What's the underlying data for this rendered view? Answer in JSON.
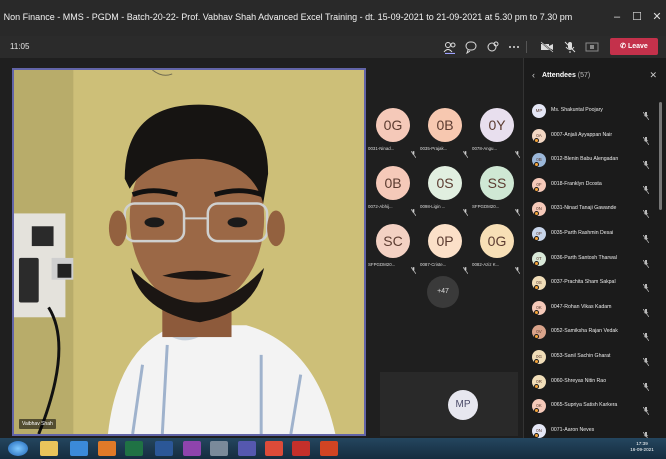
{
  "window": {
    "title": "Non Finance - MMS - PGDM - Batch-20-22- Prof. Vabhav Shah Advanced Excel Training - dt. 15-09-2021 to 21-09-2021 at 5.30 pm to 7.30 pm",
    "min_glyph": "–",
    "max_glyph": "☐",
    "close_glyph": "✕"
  },
  "callbar": {
    "timer": "11:05",
    "leave_label": "Leave",
    "icons": [
      "people-icon",
      "chat-icon",
      "reactions-icon",
      "more-icon",
      "camera-off-icon",
      "mic-off-icon",
      "share-icon"
    ]
  },
  "video": {
    "speaker_name": "Vaibhav Shah"
  },
  "grid": {
    "tiles": [
      {
        "initials": "0G",
        "label": "0031-Ninad...",
        "color": "#f5c9b9"
      },
      {
        "initials": "0B",
        "label": "0035-Prajak...",
        "color": "#f7c8b0"
      },
      {
        "initials": "0Y",
        "label": "0078-Angu...",
        "color": "#e8dfee"
      },
      {
        "initials": "0B",
        "label": "0072-Abhij...",
        "color": "#f5c9b9"
      },
      {
        "initials": "0S",
        "label": "0098-Ligin ...",
        "color": "#e1efe0"
      },
      {
        "initials": "SS",
        "label": "SFPGDM20...",
        "color": "#cfe8d4"
      },
      {
        "initials": "SC",
        "label": "SFPGDM20...",
        "color": "#f3d1c3"
      },
      {
        "initials": "0P",
        "label": "0087-Criste...",
        "color": "#fbe0c8"
      },
      {
        "initials": "0G",
        "label": "0082-Aziz K...",
        "color": "#f7dfb6"
      }
    ],
    "more_label": "+47"
  },
  "self_tile": {
    "initials": "MP"
  },
  "attendees": {
    "title": "Attendees",
    "count": "(57)",
    "back_glyph": "‹",
    "close_glyph": "✕",
    "items": [
      {
        "name": "Ms. Shakuntal Poojary",
        "initials": "MP",
        "color": "#e4e6f5",
        "status": false
      },
      {
        "name": "0007-Anjali Ayyappan Nair",
        "initials": "0A",
        "color": "#f2d6c3",
        "status": true
      },
      {
        "name": "0012-Blenin Babu Alengadan",
        "initials": "0B",
        "color": "#9bb7d9",
        "status": true
      },
      {
        "name": "0018-Franklyn Dcosta",
        "initials": "0F",
        "color": "#f5c9b9",
        "status": true
      },
      {
        "name": "0031-Ninad Tanaji Gawande",
        "initials": "0N",
        "color": "#f5c9b9",
        "status": true
      },
      {
        "name": "0035-Parth Rashmin Desai",
        "initials": "0P",
        "color": "#c8d5ea",
        "status": true
      },
      {
        "name": "0036-Parth Santosh Tharwal",
        "initials": "0T",
        "color": "#d8e8d8",
        "status": true
      },
      {
        "name": "0037-Prachita Sham Sakpal",
        "initials": "0S",
        "color": "#f0ddb8",
        "status": true
      },
      {
        "name": "0047-Rohan Vikas Kadam",
        "initials": "0K",
        "color": "#f5c9b9",
        "status": true
      },
      {
        "name": "0052-Samiksha Rajan Vedak",
        "initials": "0V",
        "color": "#d9a38a",
        "status": true
      },
      {
        "name": "0053-Sanil Sachin Gharat",
        "initials": "0G",
        "color": "#f0ddb8",
        "status": true
      },
      {
        "name": "0060-Shreyas Nitin Rao",
        "initials": "0R",
        "color": "#f0ddb8",
        "status": true
      },
      {
        "name": "0065-Supriya Satish Karkera",
        "initials": "0K",
        "color": "#f5c9b9",
        "status": true
      },
      {
        "name": "0071-Aaron Neves",
        "initials": "0N",
        "color": "#e4e6f5",
        "status": true
      }
    ]
  },
  "taskbar": {
    "time": "17:39",
    "date": "16-09-2021"
  }
}
